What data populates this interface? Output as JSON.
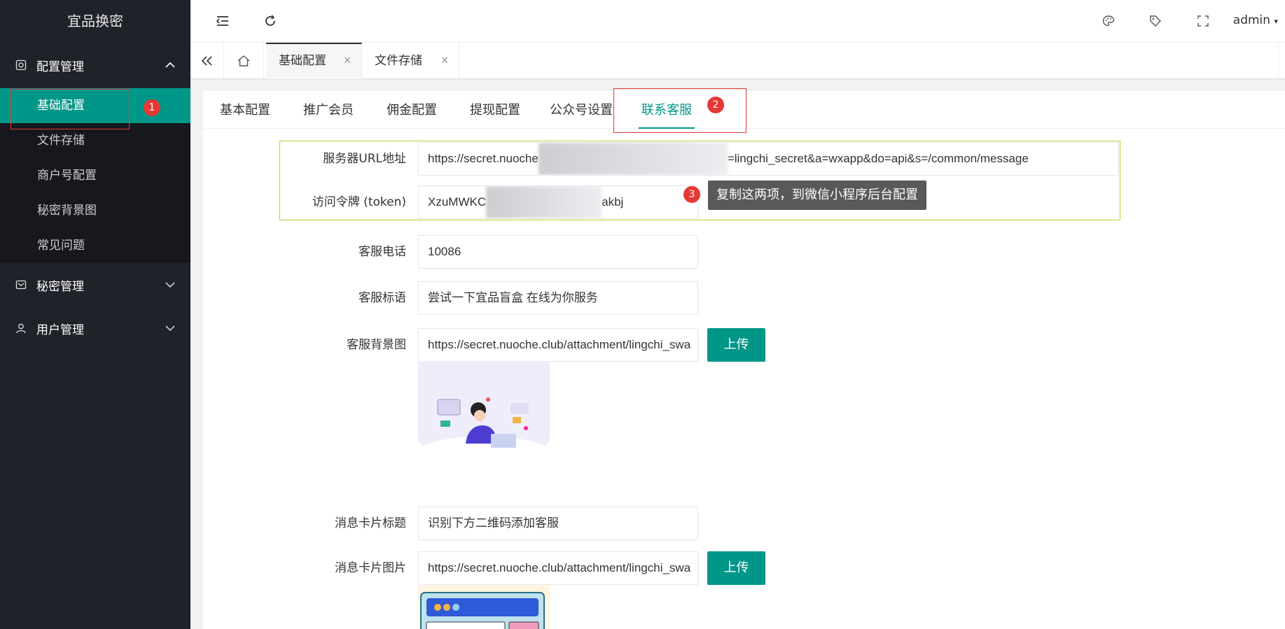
{
  "app": {
    "title": "宜品换密"
  },
  "sidebar": {
    "groups": [
      {
        "label": "配置管理",
        "expanded": true,
        "items": [
          "基础配置",
          "文件存储",
          "商户号配置",
          "秘密背景图",
          "常见问题"
        ]
      },
      {
        "label": "秘密管理",
        "expanded": false
      },
      {
        "label": "用户管理",
        "expanded": false
      }
    ]
  },
  "header": {
    "user": "admin"
  },
  "tabs": [
    "基础配置",
    "文件存储"
  ],
  "subtabs": [
    "基本配置",
    "推广会员",
    "佣金配置",
    "提现配置",
    "公众号设置",
    "联系客服"
  ],
  "annotations": {
    "badge1": "1",
    "badge2": "2",
    "badge3": "3",
    "tooltip": "复制这两项，到微信小程序后台配置"
  },
  "form": {
    "server_url": {
      "label": "服务器URL地址",
      "value_start": "https://secret.nuoche",
      "value_end": "=lingchi_secret&a=wxapp&do=api&s=/common/message"
    },
    "token": {
      "label": "访问令牌 (token)",
      "value_start": "XzuMWKC",
      "value_end": "akbj"
    },
    "phone": {
      "label": "客服电话",
      "value": "10086"
    },
    "slogan": {
      "label": "客服标语",
      "value": "尝试一下宜品盲盒 在线为你服务"
    },
    "bg_image": {
      "label": "客服背景图",
      "value": "https://secret.nuoche.club/attachment/lingchi_swa",
      "button": "上传"
    },
    "card_title": {
      "label": "消息卡片标题",
      "value": "识别下方二维码添加客服"
    },
    "card_image": {
      "label": "消息卡片图片",
      "value": "https://secret.nuoche.club/attachment/lingchi_swa",
      "button": "上传"
    }
  },
  "colors": {
    "accent": "#009688",
    "sidebar": "#20222a",
    "annotation": "#e53935",
    "highlight": "#b5d333"
  }
}
